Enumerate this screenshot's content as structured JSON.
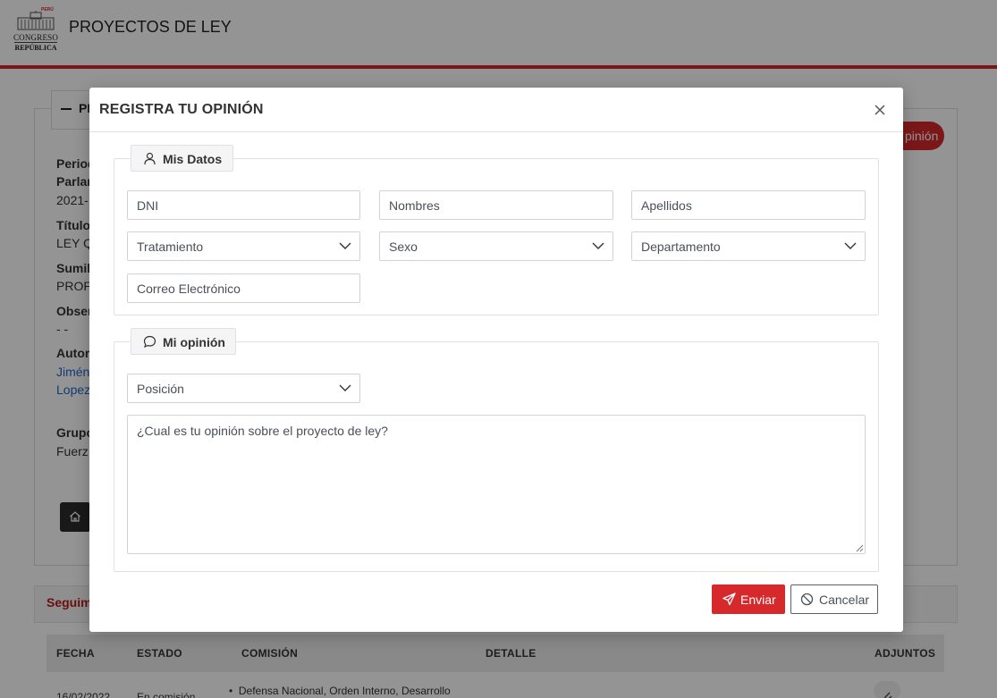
{
  "app": {
    "title": "PROYECTOS DE LEY",
    "logo_line1": "CONGRESO",
    "logo_line2": "REPÚBLICA",
    "logo_country": "PERÚ"
  },
  "background": {
    "tab_label": "PI",
    "opinion_button": "pinión",
    "fields": [
      {
        "label": "Period",
        "value": ""
      },
      {
        "label": "Parlar",
        "value": "2021-"
      },
      {
        "label": "Título",
        "value": "LEY Q"
      },
      {
        "label": "Sumil",
        "value": "PROP"
      },
      {
        "label": "Obser",
        "value": "- -"
      },
      {
        "label": "Autor",
        "value": ""
      },
      {
        "label": "Grupo",
        "value": "Fuerz"
      }
    ],
    "authors": [
      "Jiméne",
      "Lopez"
    ],
    "tracking_title": "Seguim",
    "table_headers": [
      "FECHA",
      "ESTADO",
      "COMISIÓN",
      "DETALLE",
      "ADJUNTOS"
    ],
    "first_row": {
      "fecha": "16/02/2022",
      "estado": "En comisión",
      "comision": "Defensa Nacional, Orden Interno, Desarrollo"
    }
  },
  "modal": {
    "title": "REGISTRA TU OPINIÓN",
    "section_personal": "Mis Datos",
    "section_opinion": "Mi opinión",
    "fields": {
      "dni_placeholder": "DNI",
      "nombres_placeholder": "Nombres",
      "apellidos_placeholder": "Apellidos",
      "tratamiento": "Tratamiento",
      "sexo": "Sexo",
      "departamento": "Departamento",
      "correo_placeholder": "Correo Electrónico",
      "posicion": "Posición",
      "opinion_placeholder": "¿Cual es tu opinión sobre el proyecto de ley?"
    },
    "buttons": {
      "send": "Enviar",
      "cancel": "Cancelar"
    }
  },
  "colors": {
    "brand_red": "#d6292c",
    "link_blue": "#1f67c7",
    "tracking_red": "#b71c1c"
  }
}
